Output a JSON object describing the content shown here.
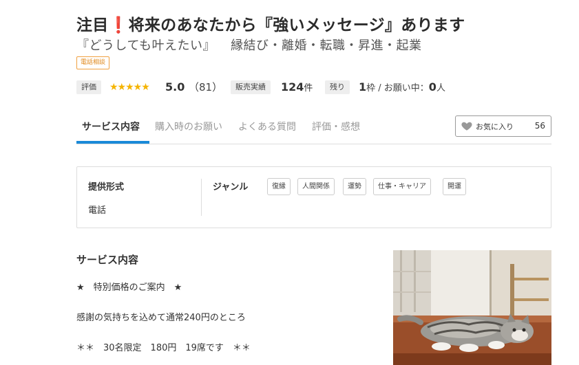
{
  "header": {
    "title_pre": "注目",
    "title_mark": "❗",
    "title_post": "将来のあなたから『強いメッセージ』あります",
    "subtitle_quote": "『どうしても叶えたい』",
    "subtitle_topics": "縁結び・離婚・転職・昇進・起業",
    "badge": "電話相談"
  },
  "stats": {
    "rating_label": "評価",
    "stars": "★★★★★",
    "rating_value": "5.0",
    "rating_count": "（81）",
    "sales_label": "販売実績",
    "sales_value": "124",
    "sales_unit": "件",
    "remaining_label": "残り",
    "remaining_value": "1",
    "remaining_unit": "枠 / お願い中：",
    "requests_value": "0",
    "requests_unit": "人"
  },
  "tabs": [
    {
      "label": "サービス内容"
    },
    {
      "label": "購入時のお願い"
    },
    {
      "label": "よくある質問"
    },
    {
      "label": "評価・感想"
    }
  ],
  "favorite": {
    "label": "お気に入り",
    "count": "56"
  },
  "info": {
    "format_label": "提供形式",
    "format_value": "電話",
    "genre_label": "ジャンル",
    "genres": [
      "復縁",
      "人間関係",
      "運勢",
      "仕事・キャリア",
      "開運"
    ]
  },
  "content": {
    "section_title": "サービス内容",
    "lines": [
      "★　特別価格のご案内　★",
      "感謝の気持ちを込めて通常240円のところ",
      "＊＊　30名限定　180円　19席です　＊＊"
    ]
  },
  "colors": {
    "accent_blue": "#1a8ad8",
    "star_yellow": "#f5b400",
    "badge_orange": "#e08a1e",
    "title_mark_red": "#e0171a"
  },
  "icons": {
    "favorite": "heart-icon",
    "rating": "star-icon"
  }
}
